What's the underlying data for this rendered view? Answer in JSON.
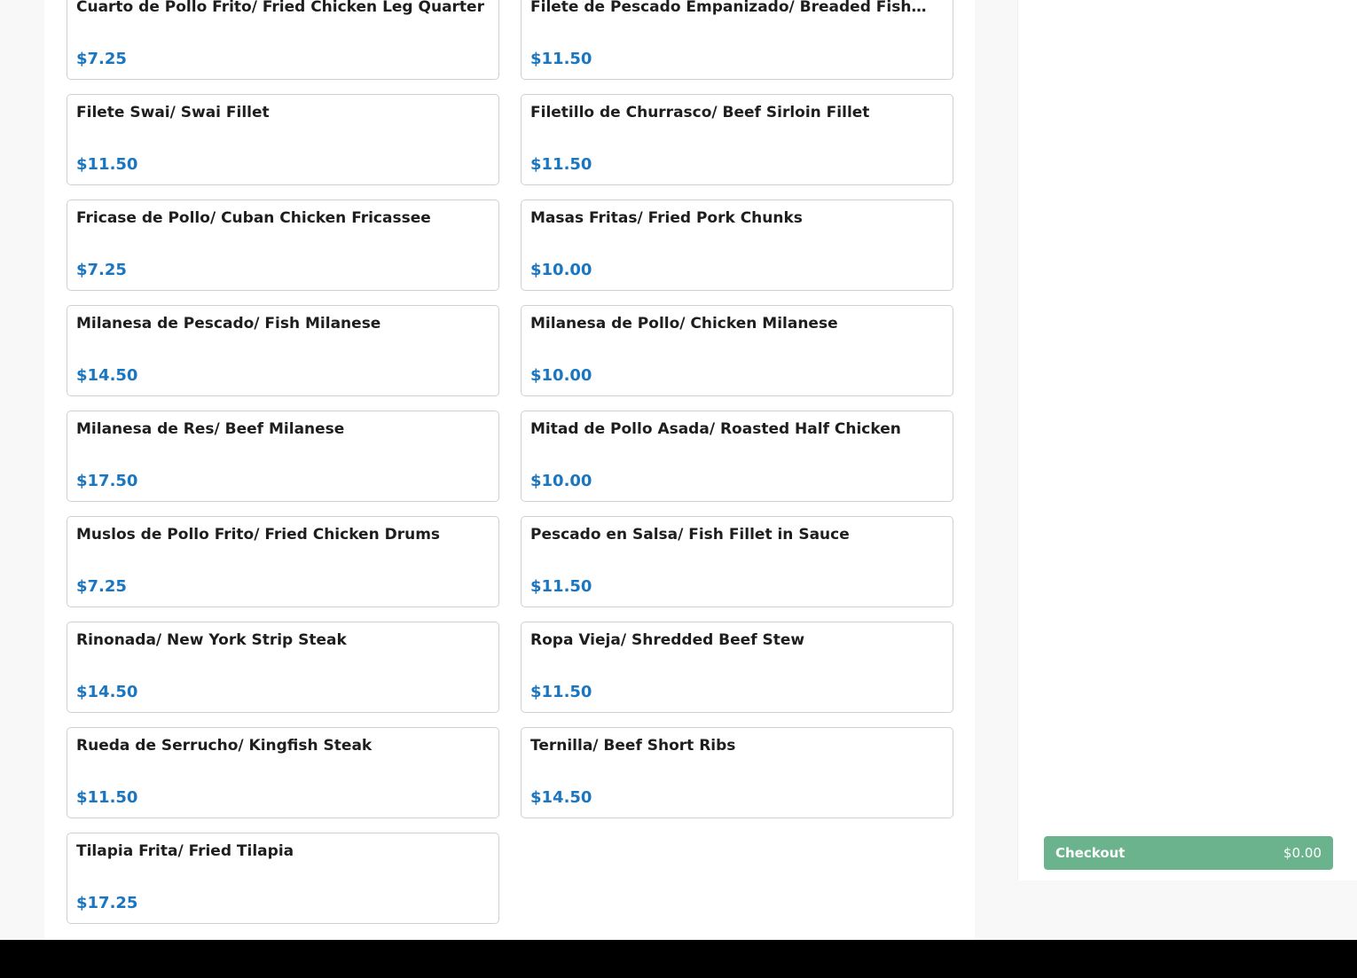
{
  "menu": {
    "items": [
      {
        "name": "Cuarto de Pollo Frito/ Fried Chicken Leg Quarter",
        "price": "$7.25"
      },
      {
        "name": "Filete de Pescado Empanizado/ Breaded Fish…",
        "price": "$11.50"
      },
      {
        "name": "Filete Swai/ Swai Fillet",
        "price": "$11.50"
      },
      {
        "name": "Filetillo de Churrasco/ Beef Sirloin Fillet",
        "price": "$11.50"
      },
      {
        "name": "Fricase de Pollo/ Cuban Chicken Fricassee",
        "price": "$7.25"
      },
      {
        "name": "Masas Fritas/ Fried Pork Chunks",
        "price": "$10.00"
      },
      {
        "name": "Milanesa de Pescado/ Fish Milanese",
        "price": "$14.50"
      },
      {
        "name": "Milanesa de Pollo/ Chicken Milanese",
        "price": "$10.00"
      },
      {
        "name": "Milanesa de Res/ Beef Milanese",
        "price": "$17.50"
      },
      {
        "name": "Mitad de Pollo Asada/ Roasted Half Chicken",
        "price": "$10.00"
      },
      {
        "name": "Muslos de Pollo Frito/ Fried Chicken Drums",
        "price": "$7.25"
      },
      {
        "name": "Pescado en Salsa/ Fish Fillet in Sauce",
        "price": "$11.50"
      },
      {
        "name": "Rinonada/ New York Strip Steak",
        "price": "$14.50"
      },
      {
        "name": "Ropa Vieja/ Shredded Beef Stew",
        "price": "$11.50"
      },
      {
        "name": "Rueda de Serrucho/ Kingfish Steak",
        "price": "$11.50"
      },
      {
        "name": "Ternilla/ Beef Short Ribs",
        "price": "$14.50"
      },
      {
        "name": "Tilapia Frita/ Fried Tilapia",
        "price": "$17.25"
      }
    ]
  },
  "cart": {
    "checkout_label": "Checkout",
    "total": "$0.00"
  },
  "colors": {
    "price": "#1a76c0",
    "checkout": "#6bb38d"
  }
}
